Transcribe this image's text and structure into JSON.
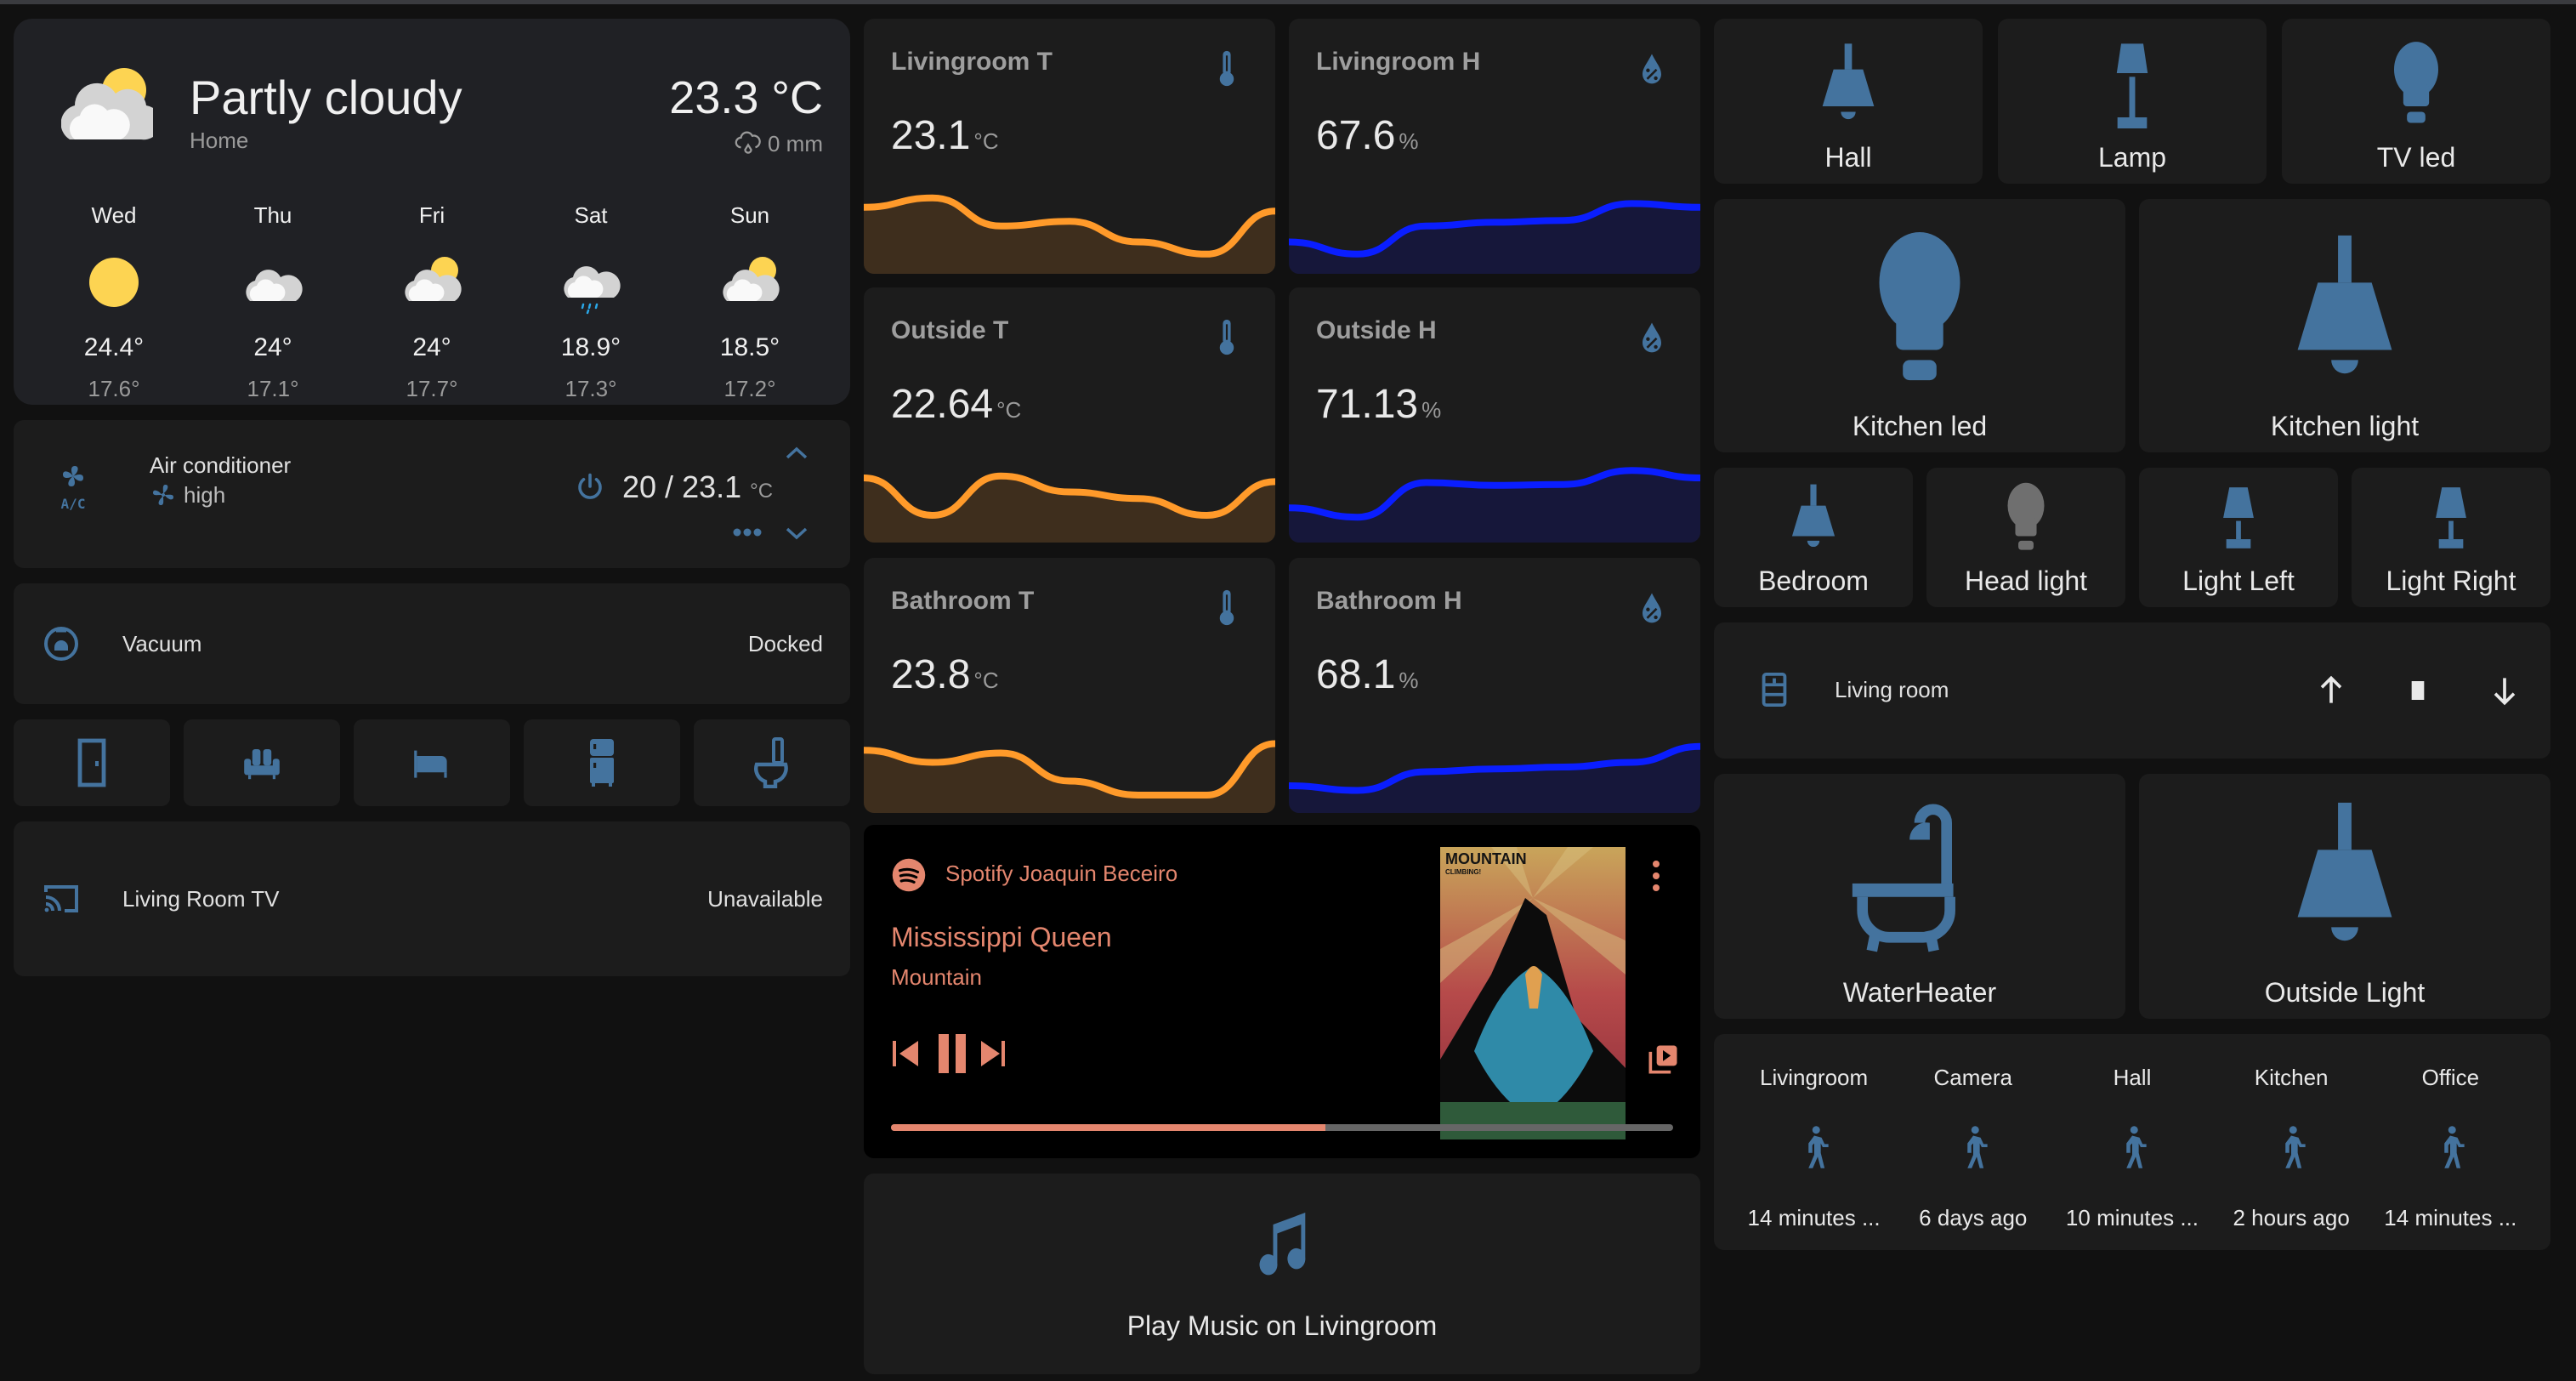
{
  "weather": {
    "condition": "Partly cloudy",
    "location": "Home",
    "temperature": "23.3 °C",
    "precipitation": "0 mm",
    "icon": "partly-cloudy-icon",
    "forecast": [
      {
        "day": "Wed",
        "icon": "sunny-icon",
        "high": "24.4°",
        "low": "17.6°"
      },
      {
        "day": "Thu",
        "icon": "cloudy-icon",
        "high": "24°",
        "low": "17.1°"
      },
      {
        "day": "Fri",
        "icon": "partly-cloudy-icon",
        "high": "24°",
        "low": "17.7°"
      },
      {
        "day": "Sat",
        "icon": "rainy-icon",
        "high": "18.9°",
        "low": "17.3°"
      },
      {
        "day": "Sun",
        "icon": "partly-cloudy-icon",
        "high": "18.5°",
        "low": "17.2°"
      }
    ]
  },
  "climate": {
    "name": "Air conditioner",
    "fan_mode": "high",
    "target": "20",
    "current": "23.1",
    "separator": " / ",
    "unit": "°C"
  },
  "vacuum": {
    "name": "Vacuum",
    "state": "Docked"
  },
  "quick_buttons": [
    {
      "icon": "door-icon"
    },
    {
      "icon": "sofa-icon"
    },
    {
      "icon": "bed-icon"
    },
    {
      "icon": "fridge-icon"
    },
    {
      "icon": "toilet-icon"
    }
  ],
  "tv": {
    "name": "Living Room TV",
    "state": "Unavailable"
  },
  "sensors": [
    {
      "name": "Livingroom T",
      "value": "23.1",
      "unit": "°C",
      "kind": "temperature",
      "history": [
        0.62,
        0.72,
        0.42,
        0.47,
        0.25,
        0.12,
        0.58
      ]
    },
    {
      "name": "Livingroom H",
      "value": "67.6",
      "unit": "%",
      "kind": "humidity",
      "history": [
        0.25,
        0.12,
        0.42,
        0.46,
        0.48,
        0.66,
        0.62
      ]
    },
    {
      "name": "Outside T",
      "value": "22.64",
      "unit": "°C",
      "kind": "temperature",
      "history": [
        0.6,
        0.2,
        0.62,
        0.45,
        0.38,
        0.2,
        0.56
      ]
    },
    {
      "name": "Outside H",
      "value": "71.13",
      "unit": "%",
      "kind": "humidity",
      "history": [
        0.28,
        0.18,
        0.55,
        0.52,
        0.53,
        0.68,
        0.6
      ]
    },
    {
      "name": "Bathroom T",
      "value": "23.8",
      "unit": "°C",
      "kind": "temperature",
      "history": [
        0.58,
        0.45,
        0.55,
        0.25,
        0.1,
        0.1,
        0.65
      ]
    },
    {
      "name": "Bathroom H",
      "value": "68.1",
      "unit": "%",
      "kind": "humidity",
      "history": [
        0.2,
        0.15,
        0.35,
        0.38,
        0.4,
        0.45,
        0.62
      ]
    }
  ],
  "media": {
    "source": "Spotify Joaquin Beceiro",
    "title": "Mississippi Queen",
    "artist": "Mountain",
    "album_art_text": [
      "MOUNTAIN",
      "CLIMBING!"
    ],
    "progress": 0.555,
    "accent": "#e4866e"
  },
  "play_music": {
    "label": "Play Music on Livingroom"
  },
  "lights_row1": [
    {
      "name": "Hall",
      "icon": "ceiling-light-icon",
      "on": true
    },
    {
      "name": "Lamp",
      "icon": "floor-lamp-icon",
      "on": true
    },
    {
      "name": "TV led",
      "icon": "lightbulb-icon",
      "on": true
    }
  ],
  "lights_row2": [
    {
      "name": "Kitchen led",
      "icon": "lightbulb-icon",
      "on": true
    },
    {
      "name": "Kitchen light",
      "icon": "ceiling-light-icon",
      "on": true
    }
  ],
  "lights_row3": [
    {
      "name": "Bedroom",
      "icon": "ceiling-light-icon",
      "on": true
    },
    {
      "name": "Head light",
      "icon": "lightbulb-icon",
      "on": false
    },
    {
      "name": "Light Left",
      "icon": "table-lamp-icon",
      "on": true
    },
    {
      "name": "Light Right",
      "icon": "table-lamp-icon",
      "on": true
    }
  ],
  "cover": {
    "name": "Living room"
  },
  "lights_row4": [
    {
      "name": "WaterHeater",
      "icon": "bathtub-icon",
      "on": true
    },
    {
      "name": "Outside Light",
      "icon": "ceiling-light-icon",
      "on": true
    }
  ],
  "motion": [
    {
      "name": "Livingroom",
      "state": "14 minutes ..."
    },
    {
      "name": "Camera",
      "state": "6 days ago"
    },
    {
      "name": "Hall",
      "state": "10 minutes ..."
    },
    {
      "name": "Kitchen",
      "state": "2 hours ago"
    },
    {
      "name": "Office",
      "state": "14 minutes ..."
    }
  ],
  "colors": {
    "icon_active": "#44739e",
    "icon_inactive": "#6f6f6f",
    "temp_line": "#ff9a2a",
    "temp_fill": "#3e2e1d",
    "hum_line": "#0a1eff",
    "hum_fill": "#16173a"
  }
}
